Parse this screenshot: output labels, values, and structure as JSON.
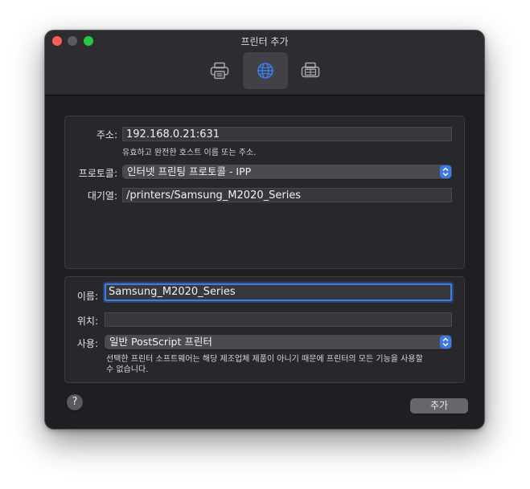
{
  "window": {
    "title": "프린터 추가"
  },
  "toolbar": {
    "items": [
      {
        "icon": "printer-default-icon",
        "selected": false
      },
      {
        "icon": "globe-icon",
        "selected": true,
        "accent": "#3b7fe6"
      },
      {
        "icon": "printer-windows-icon",
        "selected": false
      }
    ]
  },
  "form": {
    "address": {
      "label": "주소:",
      "value": "192.168.0.21:631",
      "hint": "유효하고 완전한 호스트 이름 또는 주소."
    },
    "protocol": {
      "label": "프로토콜:",
      "value": "인터넷 프린팅 프로토콜 - IPP"
    },
    "queue": {
      "label": "대기열:",
      "value": "/printers/Samsung_M2020_Series"
    },
    "name": {
      "label": "이름:",
      "value": "Samsung_M2020_Series"
    },
    "location": {
      "label": "위치:",
      "value": ""
    },
    "use": {
      "label": "사용:",
      "value": "일반 PostScript 프린터",
      "hint_line1": "선택한 프린터 소프트웨어는 해당 제조업체 제품이 아니기 때문에 프린터의 모든 기능을 사용할",
      "hint_line2": "수 없습니다."
    }
  },
  "footer": {
    "help_label": "?",
    "add_label": "추가"
  },
  "colors": {
    "accent": "#3b7fe6",
    "window_bg": "#1f1e23"
  }
}
